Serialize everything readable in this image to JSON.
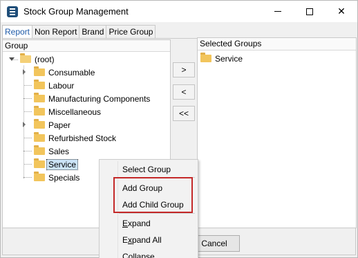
{
  "window": {
    "title": "Stock Group Management",
    "icon": "app-icon"
  },
  "tabs": [
    {
      "label": "Report",
      "active": true
    },
    {
      "label": "Non Report",
      "active": false
    },
    {
      "label": "Brand",
      "active": false
    },
    {
      "label": "Price Group",
      "active": false
    }
  ],
  "group_panel": {
    "header": "Group",
    "root": "(root)",
    "items": [
      {
        "label": "Consumable",
        "has_children": true
      },
      {
        "label": "Labour",
        "has_children": false
      },
      {
        "label": "Manufacturing Components",
        "has_children": false
      },
      {
        "label": "Miscellaneous",
        "has_children": false
      },
      {
        "label": "Paper",
        "has_children": true
      },
      {
        "label": "Refurbished Stock",
        "has_children": false
      },
      {
        "label": "Sales",
        "has_children": false
      },
      {
        "label": "Service",
        "has_children": false,
        "selected": true
      },
      {
        "label": "Specials",
        "has_children": false
      }
    ]
  },
  "transfer_buttons": {
    "add": ">",
    "remove": "<",
    "remove_all": "<<"
  },
  "selected_panel": {
    "header": "Selected Groups",
    "items": [
      "Service"
    ]
  },
  "footer": {
    "cancel_label": "Cancel"
  },
  "context_menu": {
    "items": [
      {
        "label": "Select Group",
        "accel": ""
      },
      {
        "label": "Add Group",
        "accel": ""
      },
      {
        "label": "Add Child Group",
        "accel": ""
      },
      {
        "label": "Expand",
        "accel": "E"
      },
      {
        "label": "Expand All",
        "accel": "x"
      },
      {
        "label": "Collapse",
        "accel": ""
      }
    ],
    "highlight_color": "#c42828"
  },
  "colors": {
    "folder": "#f2c55c",
    "selection": "#cce4f7",
    "active_tab_text": "#1e5aa8"
  }
}
